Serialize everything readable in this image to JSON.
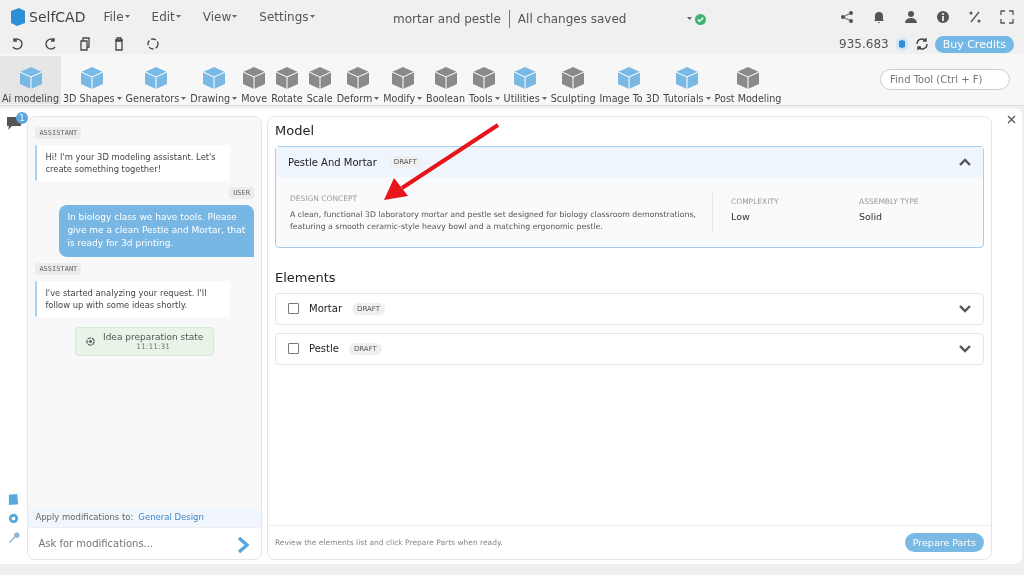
{
  "app": {
    "name": "SelfCAD",
    "menus": [
      {
        "label": "File"
      },
      {
        "label": "Edit"
      },
      {
        "label": "View"
      },
      {
        "label": "Settings"
      }
    ],
    "project_name": "mortar and pestle",
    "save_status": "All changes saved",
    "saved": true
  },
  "credits": {
    "amount": "935.683",
    "buy_label": "Buy Credits"
  },
  "toolbar": {
    "tools": [
      {
        "label": "Ai modeling",
        "kind": "feature",
        "dropdown": false,
        "selected": true
      },
      {
        "label": "3D Shapes",
        "kind": "feature",
        "dropdown": true,
        "selected": false
      },
      {
        "label": "Generators",
        "kind": "feature",
        "dropdown": true,
        "selected": false
      },
      {
        "label": "Drawing",
        "kind": "feature",
        "dropdown": true,
        "selected": false
      },
      {
        "label": "Move",
        "kind": "tool",
        "dropdown": false,
        "selected": false
      },
      {
        "label": "Rotate",
        "kind": "tool",
        "dropdown": false,
        "selected": false
      },
      {
        "label": "Scale",
        "kind": "tool",
        "dropdown": false,
        "selected": false
      },
      {
        "label": "Deform",
        "kind": "tool",
        "dropdown": true,
        "selected": false
      },
      {
        "label": "Modify",
        "kind": "tool",
        "dropdown": true,
        "selected": false
      },
      {
        "label": "Boolean",
        "kind": "tool",
        "dropdown": false,
        "selected": false
      },
      {
        "label": "Tools",
        "kind": "tool",
        "dropdown": true,
        "selected": false
      },
      {
        "label": "Utilities",
        "kind": "feature",
        "dropdown": true,
        "selected": false
      },
      {
        "label": "Sculpting",
        "kind": "tool",
        "dropdown": false,
        "selected": false
      },
      {
        "label": "Image To 3D",
        "kind": "feature",
        "dropdown": false,
        "selected": false
      },
      {
        "label": "Tutorials",
        "kind": "feature",
        "dropdown": true,
        "selected": false
      },
      {
        "label": "Post Modeling",
        "kind": "tool",
        "dropdown": false,
        "selected": false
      }
    ],
    "find_placeholder": "Find Tool (Ctrl + F)"
  },
  "side_rail": {
    "chat_badge": "1"
  },
  "chat": {
    "messages": [
      {
        "role": "ASSISTANT",
        "kind": "assistant",
        "text": "Hi! I'm your 3D modeling assistant. Let's create something together!"
      },
      {
        "role": "USER",
        "kind": "user",
        "text": "In biology class we have tools. Please give me a clean Pestle and Mortar, that is ready for 3d printing."
      },
      {
        "role": "ASSISTANT",
        "kind": "assistant",
        "text": "I've started analyzing your request. I'll follow up with some ideas shortly."
      }
    ],
    "status": {
      "label": "Idea preparation state",
      "time": "11:11:31"
    },
    "apply_label": "Apply modifications to:",
    "apply_target": "General Design",
    "input_placeholder": "Ask for modifications..."
  },
  "model": {
    "heading": "Model",
    "name": "Pestle And Mortar",
    "badge": "DRAFT",
    "expanded": true,
    "concept_label": "DESIGN CONCEPT",
    "concept": "A clean, functional 3D laboratory mortar and pestle set designed for biology classroom demonstrations, featuring a smooth ceramic-style heavy bowl and a matching ergonomic pestle.",
    "complexity_label": "COMPLEXITY",
    "complexity": "Low",
    "assembly_label": "ASSEMBLY TYPE",
    "assembly": "Solid"
  },
  "elements": {
    "heading": "Elements",
    "items": [
      {
        "name": "Mortar",
        "badge": "DRAFT",
        "checked": false,
        "expanded": false
      },
      {
        "name": "Pestle",
        "badge": "DRAFT",
        "checked": false,
        "expanded": false
      }
    ]
  },
  "footer": {
    "hint": "Review the elements list and click Prepare Parts when ready.",
    "button": "Prepare Parts"
  }
}
